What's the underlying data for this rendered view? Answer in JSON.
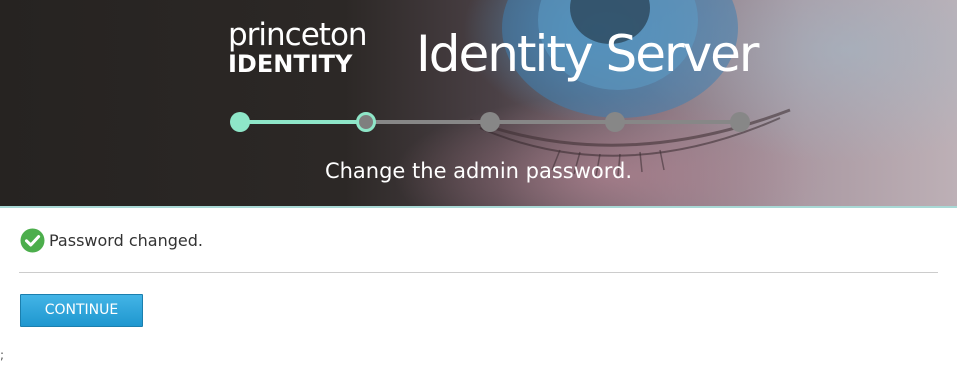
{
  "header": {
    "logo_line1": "princeton",
    "logo_line2": "IDENTITY",
    "title": "Identity Server",
    "subtitle": "Change the admin password."
  },
  "stepper": {
    "total_steps": 5,
    "current_step": 2,
    "colors": {
      "done": "#8ee6c8",
      "pending": "#878787"
    }
  },
  "status": {
    "icon": "check-circle-icon",
    "icon_color": "#4cae4c",
    "message": "Password changed."
  },
  "actions": {
    "continue_label": "CONTINUE",
    "continue_color": "#2aa3d9"
  },
  "footer": {
    "stray_char": ";"
  }
}
